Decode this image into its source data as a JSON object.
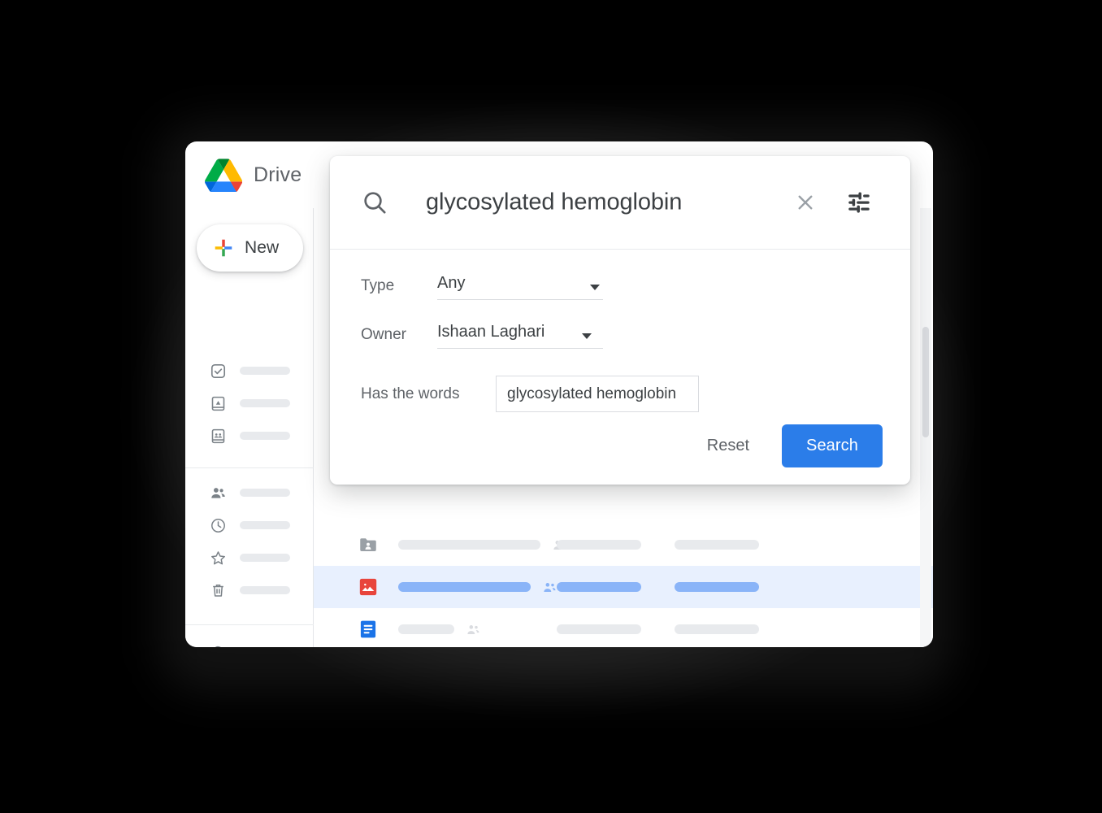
{
  "app": {
    "name": "Drive",
    "logo_icon": "google-drive-logo"
  },
  "sidebar": {
    "new_button": {
      "label": "New",
      "icon": "plus-icon"
    },
    "groups": [
      {
        "items": [
          {
            "icon": "check-square-icon",
            "label": ""
          },
          {
            "icon": "my-drive-icon",
            "label": ""
          },
          {
            "icon": "shared-drives-icon",
            "label": ""
          }
        ]
      },
      {
        "items": [
          {
            "icon": "people-icon",
            "label": ""
          },
          {
            "icon": "clock-icon",
            "label": ""
          },
          {
            "icon": "star-icon",
            "label": ""
          },
          {
            "icon": "trash-icon",
            "label": ""
          }
        ]
      },
      {
        "items": [
          {
            "icon": "cloud-icon",
            "label": ""
          }
        ]
      }
    ]
  },
  "file_list": {
    "rows": [
      {
        "icon": "shared-folder-icon",
        "shared_icon": "people-icon",
        "selected": false
      },
      {
        "icon": "image-file-icon",
        "shared_icon": "people-icon",
        "selected": true
      },
      {
        "icon": "google-docs-icon",
        "shared_icon": "people-icon",
        "selected": false
      }
    ]
  },
  "search_dialog": {
    "search_icon": "search-icon",
    "query": "glycosylated hemoglobin",
    "clear_icon": "close-icon",
    "tune_icon": "tune-filter-icon",
    "fields": {
      "type": {
        "label": "Type",
        "value": "Any",
        "caret_icon": "chevron-down-icon"
      },
      "owner": {
        "label": "Owner",
        "value": "Ishaan Laghari",
        "caret_icon": "chevron-down-icon"
      },
      "has_the_words": {
        "label": "Has the words",
        "value": "glycosylated hemoglobin"
      }
    },
    "actions": {
      "reset_label": "Reset",
      "search_label": "Search"
    }
  },
  "colors": {
    "accent_blue": "#2b7de9",
    "selected_row_bg": "#e8f0fe",
    "selected_bar": "#8ab4f8",
    "placeholder_bar": "#e8eaed",
    "text_primary": "#3c4043",
    "text_secondary": "#5f6368"
  }
}
